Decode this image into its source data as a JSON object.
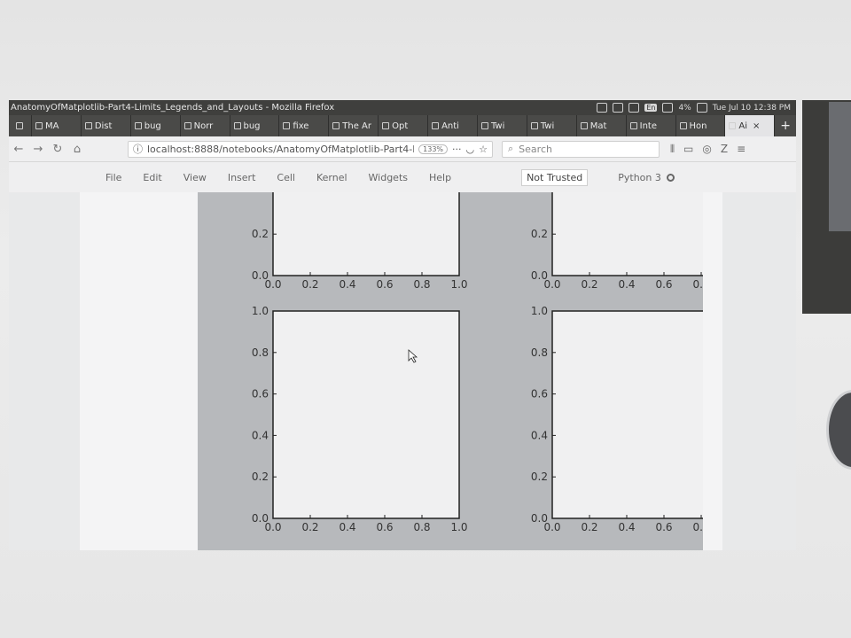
{
  "window": {
    "title": "AnatomyOfMatplotlib-Part4-Limits_Legends_and_Layouts - Mozilla Firefox",
    "clock": "Tue Jul 10 12:38 PM",
    "lang_badge": "En",
    "battery": "4%"
  },
  "tabs": [
    {
      "label": "MA"
    },
    {
      "label": "Dist"
    },
    {
      "label": "bug"
    },
    {
      "label": "Norr"
    },
    {
      "label": "bug"
    },
    {
      "label": "fixe"
    },
    {
      "label": "The Ar"
    },
    {
      "label": "Opt"
    },
    {
      "label": "Anti"
    },
    {
      "label": "Twi"
    },
    {
      "label": "Twi"
    },
    {
      "label": "Mat"
    },
    {
      "label": "Inte"
    },
    {
      "label": "Hon"
    },
    {
      "label": "Ai",
      "active": true
    }
  ],
  "nav": {
    "url": "localhost:8888/notebooks/AnatomyOfMatplotlib-Part4-L",
    "zoom": "133%",
    "search_placeholder": "Search"
  },
  "menu": {
    "items": [
      "File",
      "Edit",
      "View",
      "Insert",
      "Cell",
      "Kernel",
      "Widgets",
      "Help"
    ],
    "trust": "Not Trusted",
    "kernel": "Python 3"
  },
  "chart_data": [
    {
      "type": "line",
      "panel": "top-left (partially visible)",
      "xticks": [
        "0.0",
        "0.2",
        "0.4",
        "0.6",
        "0.8",
        "1.0"
      ],
      "yticks": [
        "0.0",
        "0.2"
      ],
      "xlim": [
        0,
        1
      ],
      "ylim": [
        0,
        1
      ],
      "series": []
    },
    {
      "type": "line",
      "panel": "top-right (partially visible)",
      "xticks": [
        "0.0",
        "0.2",
        "0.4",
        "0.6",
        "0.8",
        "0."
      ],
      "yticks": [
        "0.0",
        "0.2"
      ],
      "xlim": [
        0,
        1
      ],
      "ylim": [
        0,
        1
      ],
      "series": []
    },
    {
      "type": "line",
      "panel": "bottom-left",
      "xticks": [
        "0.0",
        "0.2",
        "0.4",
        "0.6",
        "0.8",
        "1.0"
      ],
      "yticks": [
        "0.0",
        "0.2",
        "0.4",
        "0.6",
        "0.8",
        "1.0"
      ],
      "xlim": [
        0,
        1
      ],
      "ylim": [
        0,
        1
      ],
      "series": []
    },
    {
      "type": "line",
      "panel": "bottom-right",
      "xticks": [
        "0.0",
        "0.2",
        "0.4",
        "0.6",
        "0.8",
        "0."
      ],
      "yticks": [
        "0.0",
        "0.2",
        "0.4",
        "0.6",
        "0.8",
        "1.0"
      ],
      "xlim": [
        0,
        1
      ],
      "ylim": [
        0,
        1
      ],
      "series": []
    }
  ],
  "colors": {
    "figure_bg": "#b7b9bc",
    "axes_bg": "#f0f0f1"
  }
}
